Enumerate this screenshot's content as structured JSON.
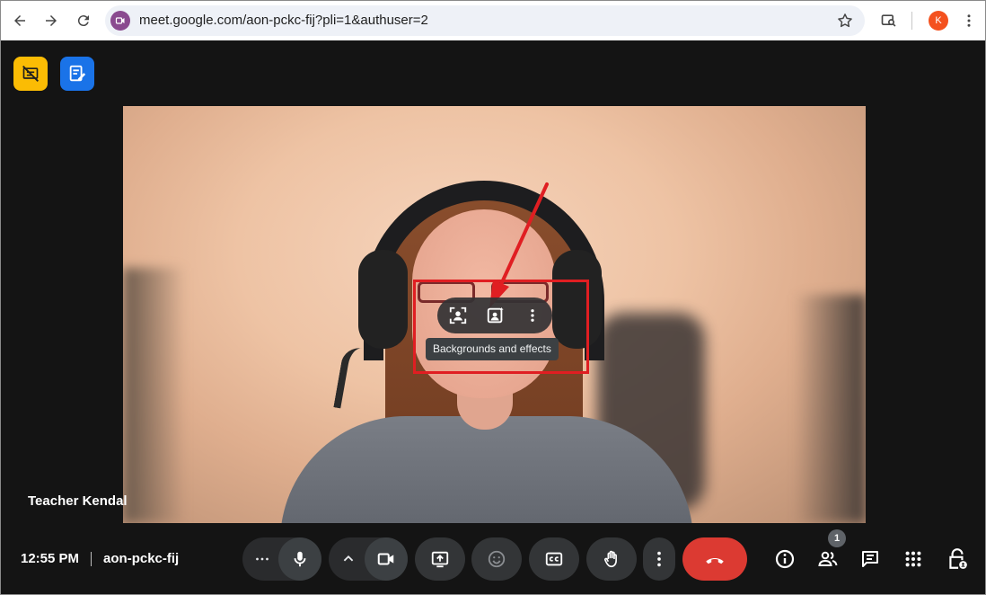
{
  "browser": {
    "url": "meet.google.com/aon-pckc-fij?pli=1&authuser=2",
    "profile_initial": "K",
    "profile_color": "#f4511e"
  },
  "meet": {
    "participant_name": "Teacher Kendal",
    "time": "12:55 PM",
    "meeting_code": "aon-pckc-fij",
    "self_view_menu": {
      "tooltip": "Backgrounds and effects",
      "icons": [
        "framing-icon",
        "backgrounds-effects-icon",
        "more-options-icon"
      ]
    },
    "people_count": "1",
    "highlight_color": "#e01e22",
    "leave_color": "#dc3a32",
    "top_left_icons": [
      "slides-off-icon",
      "notes-edit-icon"
    ]
  }
}
